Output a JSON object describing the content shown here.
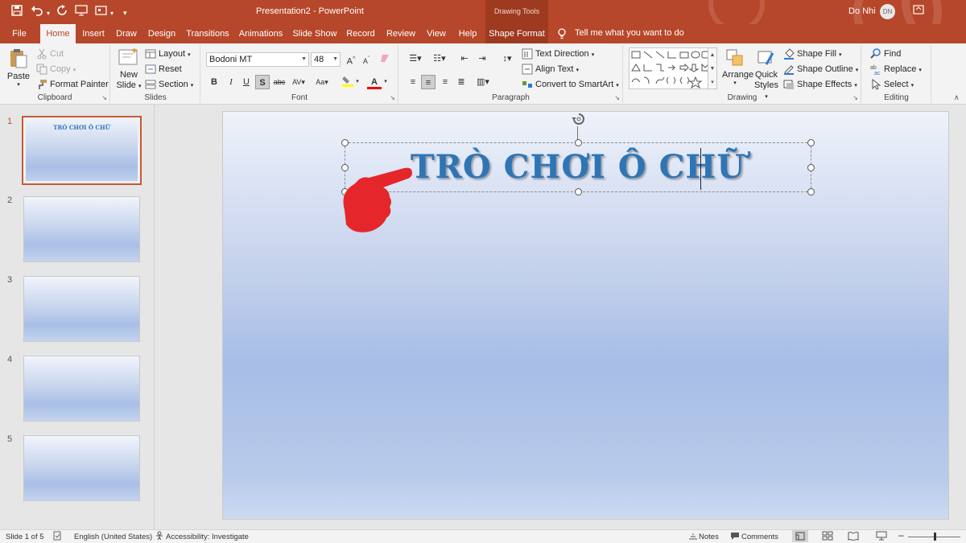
{
  "window": {
    "title": "Presentation2 - PowerPoint",
    "context_tools": "Drawing Tools",
    "user_name": "Do Nhi",
    "user_initials": "DN"
  },
  "tabs": [
    {
      "label": "File"
    },
    {
      "label": "Home"
    },
    {
      "label": "Insert"
    },
    {
      "label": "Draw"
    },
    {
      "label": "Design"
    },
    {
      "label": "Transitions"
    },
    {
      "label": "Animations"
    },
    {
      "label": "Slide Show"
    },
    {
      "label": "Record"
    },
    {
      "label": "Review"
    },
    {
      "label": "View"
    },
    {
      "label": "Help"
    },
    {
      "label": "Shape Format"
    }
  ],
  "tell_me": "Tell me what you want to do",
  "ribbon": {
    "clipboard": {
      "label": "Clipboard",
      "paste": "Paste",
      "cut": "Cut",
      "copy": "Copy",
      "format_painter": "Format Painter"
    },
    "slides": {
      "label": "Slides",
      "new_slide_1": "New",
      "new_slide_2": "Slide",
      "layout": "Layout",
      "reset": "Reset",
      "section": "Section"
    },
    "font": {
      "label": "Font",
      "font_name": "Bodoni MT",
      "font_size": "48"
    },
    "paragraph": {
      "label": "Paragraph",
      "text_direction": "Text Direction",
      "align_text": "Align Text",
      "convert_smartart": "Convert to SmartArt"
    },
    "drawing": {
      "label": "Drawing",
      "arrange": "Arrange",
      "quick_styles_1": "Quick",
      "quick_styles_2": "Styles",
      "shape_fill": "Shape Fill",
      "shape_outline": "Shape Outline",
      "shape_effects": "Shape Effects"
    },
    "editing": {
      "label": "Editing",
      "find": "Find",
      "replace": "Replace",
      "select": "Select"
    }
  },
  "slides": [
    {
      "number": "1",
      "title": "TRÒ CHƠI Ô CHỮ",
      "selected": true
    },
    {
      "number": "2"
    },
    {
      "number": "3"
    },
    {
      "number": "4"
    },
    {
      "number": "5"
    }
  ],
  "slide": {
    "title": "TRÒ CHƠI Ô CHỮ"
  },
  "status": {
    "slide_pos": "Slide 1 of 5",
    "language": "English (United States)",
    "accessibility": "Accessibility: Investigate",
    "notes": "Notes",
    "comments": "Comments"
  },
  "colors": {
    "accent": "#b7472a",
    "title_text": "#2e75b6",
    "pointer": "#e5262a"
  },
  "icons": [
    "save-icon",
    "undo-icon",
    "redo-icon",
    "paste-icon",
    "find-icon",
    "lightbulb-icon",
    "hand-pointer-icon"
  ]
}
